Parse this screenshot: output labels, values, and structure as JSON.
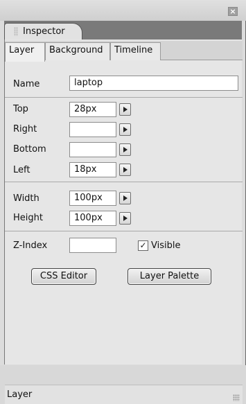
{
  "window": {
    "close_symbol": "×"
  },
  "panel_tab": {
    "label": "Inspector"
  },
  "tabs": [
    "Layer",
    "Background",
    "Timeline"
  ],
  "fields": {
    "name": {
      "label": "Name",
      "value": "laptop"
    },
    "top": {
      "label": "Top",
      "value": "28px"
    },
    "right": {
      "label": "Right",
      "value": ""
    },
    "bottom": {
      "label": "Bottom",
      "value": ""
    },
    "left": {
      "label": "Left",
      "value": "18px"
    },
    "width": {
      "label": "Width",
      "value": "100px"
    },
    "height": {
      "label": "Height",
      "value": "100px"
    },
    "zindex": {
      "label": "Z-Index",
      "value": ""
    }
  },
  "visible": {
    "label": "Visible",
    "checked": true,
    "mark": "✓"
  },
  "buttons": {
    "css_editor": "CSS Editor",
    "layer_palette": "Layer Palette"
  },
  "status": {
    "label": "Layer"
  },
  "icons": {
    "close": "close-icon",
    "grip": "grip-icon",
    "arrow": "arrow-right-icon",
    "resize": "resize-grip-icon"
  }
}
